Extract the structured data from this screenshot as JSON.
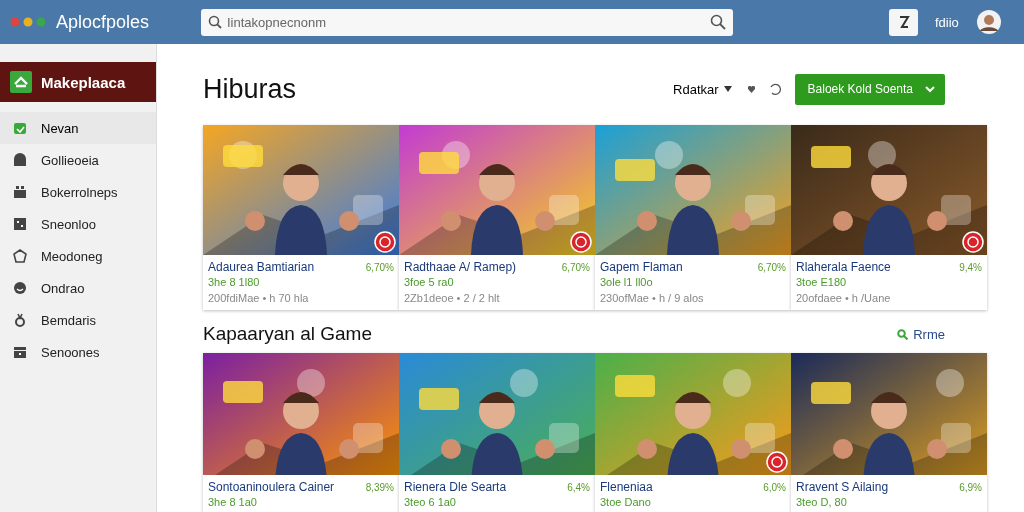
{
  "app": {
    "title": "Aplocfpoles"
  },
  "search": {
    "placeholder": "Iintakopnecnonm"
  },
  "header": {
    "user": "fdiio"
  },
  "sidebar": {
    "title": "Makeplaaca",
    "items": [
      {
        "label": "Nevan",
        "selected": true
      },
      {
        "label": "Gollieoeia",
        "selected": false
      },
      {
        "label": "Bokerrolneps",
        "selected": false
      },
      {
        "label": "Sneonloo",
        "selected": false
      },
      {
        "label": "Meodoneg",
        "selected": false
      },
      {
        "label": "Ondrao",
        "selected": false
      },
      {
        "label": "Bemdaris",
        "selected": false
      },
      {
        "label": "Senoones",
        "selected": false
      }
    ]
  },
  "sections": [
    {
      "title": "Hiburas",
      "sort": "Rdatkar",
      "action": "Baloek Kold Soenta",
      "cards": [
        {
          "title": "Adaurea Bamtiarian",
          "discount": "6,70%",
          "price": "3he 8 1l80",
          "meta": "200fdiMae • h 70 hla",
          "badge": true
        },
        {
          "title": "Radthaae A/ Ramep)",
          "discount": "6,70%",
          "price": "3foe 5 ra0",
          "meta": "2Zb1deoe • 2 / 2 hlt",
          "badge": true
        },
        {
          "title": "Gapem Flaman",
          "discount": "6,70%",
          "price": "3ole l1 ll0o",
          "meta": "230ofMae • h / 9 alos",
          "badge": false
        },
        {
          "title": "Rlaherala Faence",
          "discount": "9,4%",
          "price": "3toe E180",
          "meta": "20ofdaee • h /Uane",
          "badge": true
        }
      ]
    },
    {
      "title": "Kapaaryan al Game",
      "link": "Rrme",
      "cards": [
        {
          "title": "Sontoaninoulera Cainer",
          "discount": "8,39%",
          "price": "3he 8 1a0",
          "badge": false
        },
        {
          "title": "Rienera Dle Searta",
          "discount": "6,4%",
          "price": "3teo 6 1a0",
          "badge": false
        },
        {
          "title": "Fleneniaa",
          "discount": "6,0%",
          "price": "3toe Dano",
          "badge": true
        },
        {
          "title": "Rravent S Ailaing",
          "discount": "6,9%",
          "price": "3teo D, 80",
          "badge": false
        }
      ]
    }
  ]
}
